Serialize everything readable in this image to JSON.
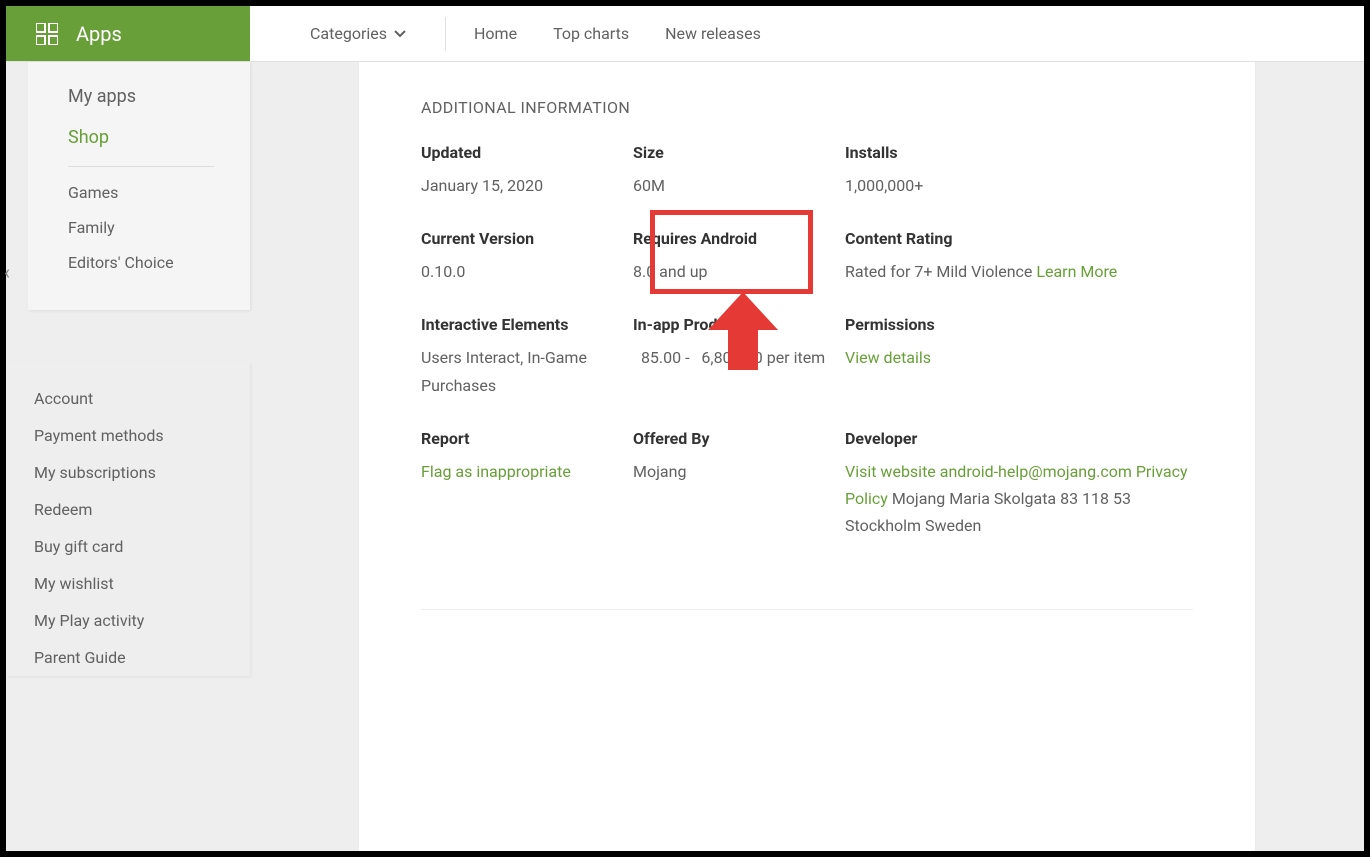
{
  "header": {
    "brand": "Apps",
    "categories_label": "Categories",
    "nav": {
      "home": "Home",
      "top_charts": "Top charts",
      "new_releases": "New releases"
    }
  },
  "sidebar": {
    "my_apps": "My apps",
    "shop": "Shop",
    "games": "Games",
    "family": "Family",
    "editors_choice": "Editors' Choice",
    "account": "Account",
    "payment_methods": "Payment methods",
    "my_subscriptions": "My subscriptions",
    "redeem": "Redeem",
    "buy_gift_card": "Buy gift card",
    "my_wishlist": "My wishlist",
    "my_play_activity": "My Play activity",
    "parent_guide": "Parent Guide"
  },
  "section_title": "ADDITIONAL INFORMATION",
  "info": {
    "updated": {
      "label": "Updated",
      "value": "January 15, 2020"
    },
    "size": {
      "label": "Size",
      "value": "60M"
    },
    "installs": {
      "label": "Installs",
      "value": "1,000,000+"
    },
    "current_version": {
      "label": "Current Version",
      "value": "0.10.0"
    },
    "requires_android": {
      "label": "Requires Android",
      "value": "8.0 and up"
    },
    "content_rating": {
      "label": "Content Rating",
      "line1": "Rated for 7+",
      "line2": "Mild Violence",
      "learn_more": "Learn More"
    },
    "interactive_elements": {
      "label": "Interactive Elements",
      "value": "Users Interact, In-Game Purchases"
    },
    "inapp_products": {
      "label": "In-app Products",
      "value": "  85.00 -   6,800.00 per item"
    },
    "permissions": {
      "label": "Permissions",
      "view_details": "View details"
    },
    "report": {
      "label": "Report",
      "flag": "Flag as inappropriate"
    },
    "offered_by": {
      "label": "Offered By",
      "value": "Mojang"
    },
    "developer": {
      "label": "Developer",
      "visit_website": "Visit website",
      "email": "android-help@mojang.com",
      "privacy": "Privacy Policy",
      "addr1": "Mojang Maria Skolgata",
      "addr2": "83 118 53 Stockholm",
      "addr3": "Sweden"
    }
  }
}
